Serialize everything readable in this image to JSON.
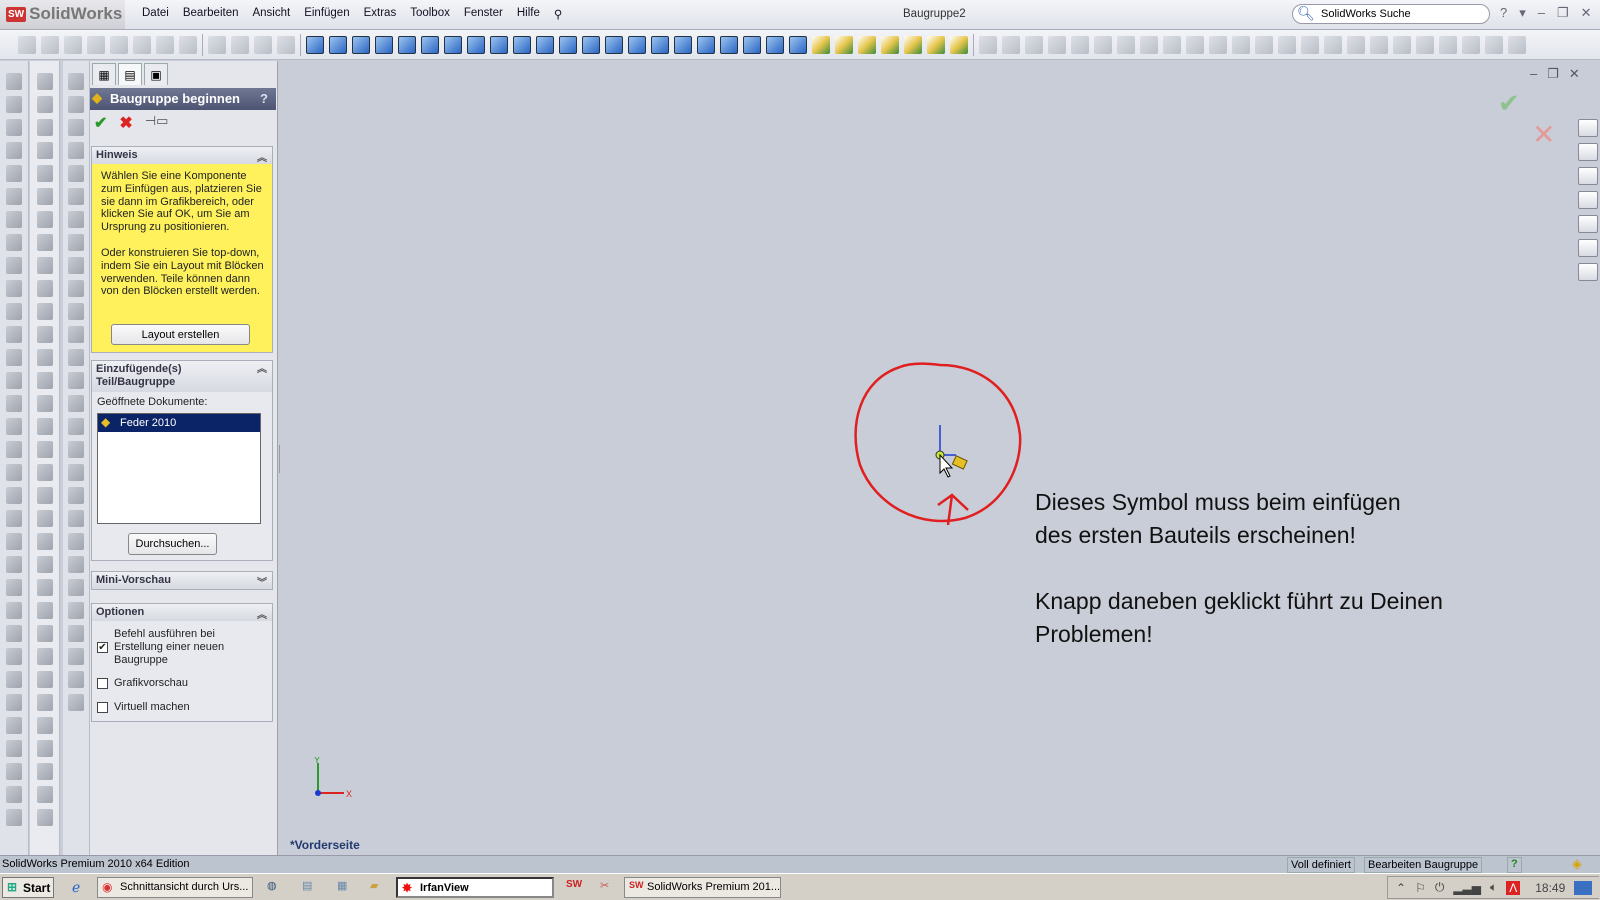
{
  "app": {
    "name": "SolidWorks",
    "logo_badge": "SW",
    "document_title": "Baugruppe2"
  },
  "menu": [
    "Datei",
    "Bearbeiten",
    "Ansicht",
    "Einfügen",
    "Extras",
    "Toolbox",
    "Fenster",
    "Hilfe"
  ],
  "search": {
    "placeholder": "SolidWorks Suche"
  },
  "property_manager": {
    "title": "Baugruppe beginnen",
    "help": "?",
    "hint": {
      "title": "Hinweis",
      "text1": "Wählen Sie eine Komponente zum Einfügen aus, platzieren Sie sie dann im Grafikbereich, oder klicken Sie auf OK, um Sie am Ursprung zu positionieren.",
      "text2": "Oder konstruieren Sie top-down, indem Sie ein Layout mit Blöcken verwenden. Teile können dann von den Blöcken erstellt werden.",
      "button": "Layout erstellen"
    },
    "insert": {
      "title": "Einzufügende(s) Teil/Baugruppe",
      "opened_label": "Geöffnete Dokumente:",
      "documents": [
        "Feder 2010"
      ],
      "browse": "Durchsuchen..."
    },
    "mini_preview": {
      "title": "Mini-Vorschau"
    },
    "options": {
      "title": "Optionen",
      "items": [
        {
          "label": "Befehl ausführen bei Erstellung einer neuen Baugruppe",
          "checked": true
        },
        {
          "label": "Grafikvorschau",
          "checked": false
        },
        {
          "label": "Virtuell machen",
          "checked": false
        }
      ]
    }
  },
  "graphics": {
    "view_label": "*Vorderseite",
    "annotation": "Dieses Symbol muss beim einfügen\ndes ersten Bauteils erscheinen!\n\nKnapp daneben geklickt führt zu Deinen\nProblemen!",
    "annotation_color": "#e02020",
    "triad": {
      "x": "X",
      "y": "Y"
    }
  },
  "statusbar": {
    "left": "SolidWorks Premium 2010 x64 Edition",
    "status": "Voll definiert",
    "mode": "Bearbeiten Baugruppe",
    "help": "?"
  },
  "taskbar": {
    "start": "Start",
    "items": [
      "Schnittansicht durch Urs...",
      "IrfanView",
      "SolidWorks Premium 201..."
    ],
    "clock": "18:49"
  }
}
